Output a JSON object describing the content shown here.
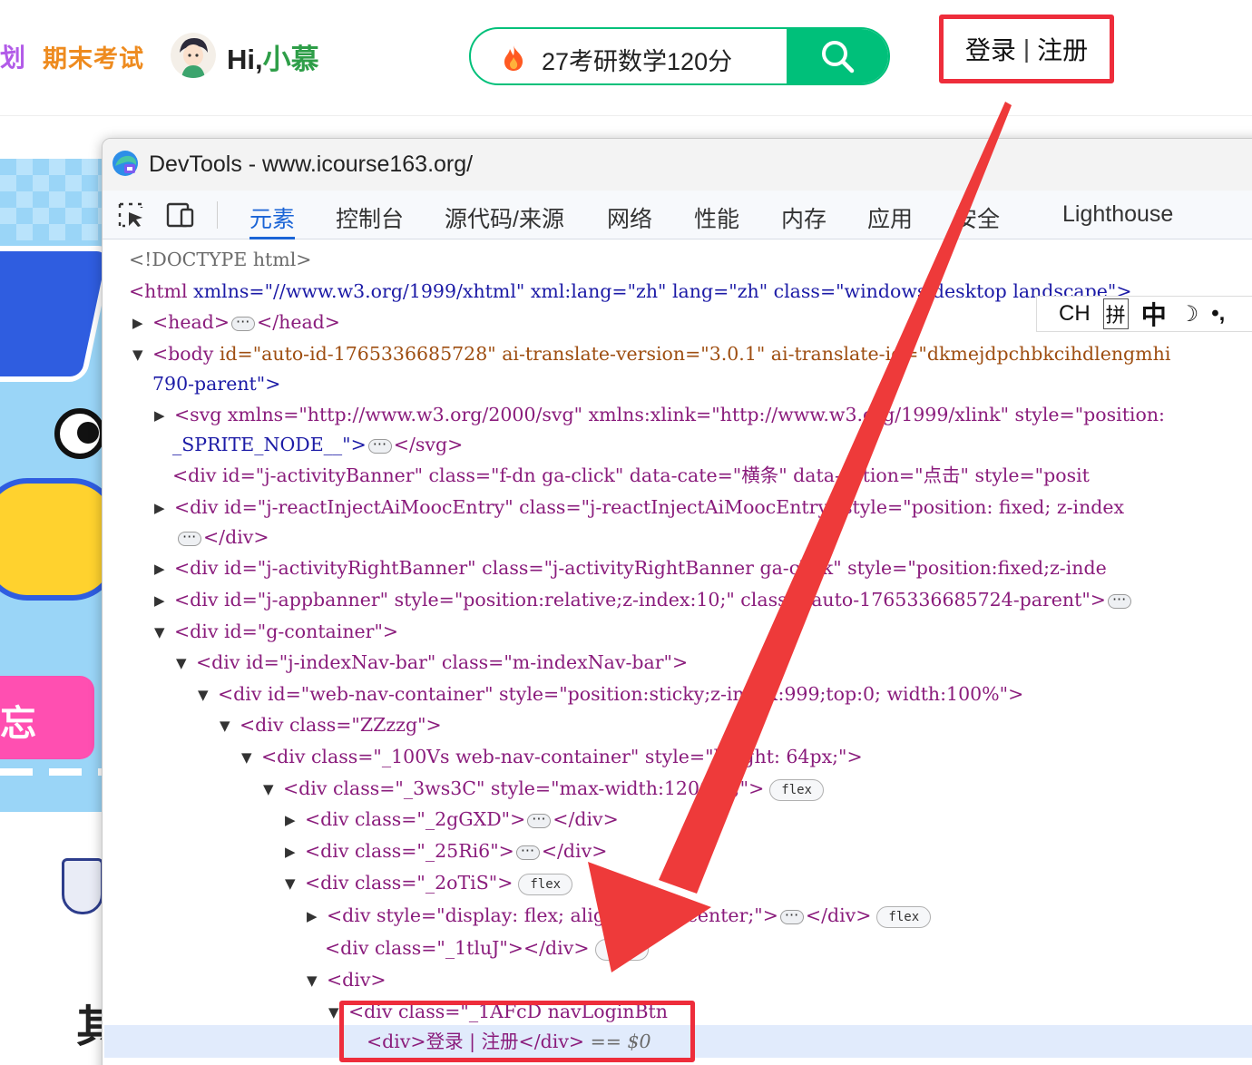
{
  "site": {
    "nav_partial": "划",
    "nav_exam": "期末考试",
    "greeting_hi": "Hi,",
    "greeting_name": "小慕",
    "search_query": "27考研数学120分",
    "login": "登录",
    "register": "注册",
    "login_sep": "|"
  },
  "background": {
    "banner_text": "忘",
    "page_char": "其",
    "page_dots": "..."
  },
  "devtools": {
    "title": "DevTools - www.icourse163.org/",
    "tabs": [
      "元素",
      "控制台",
      "源代码/来源",
      "网络",
      "性能",
      "内存",
      "应用",
      "安全",
      "Lighthouse"
    ],
    "active_tab": 0,
    "ime": {
      "ch": "CH",
      "pin": "拼",
      "zhong": "中",
      "moon": "☽",
      "dot": "•,"
    }
  },
  "dom_lines": {
    "l1": "<!DOCTYPE html>",
    "l2_tag": "<html",
    "l2_rest": " xmlns=\"//www.w3.org/1999/xhtml\" xml:lang=\"zh\" lang=\"zh\" class=\"windows desktop landscape\">",
    "l3_open": "<head>",
    "l3_close": "</head>",
    "l4_tag": "<body",
    "l4_attrs": " id=\"auto-id-1765336685728\" ai-translate-version=\"3.0.1\" ai-translate-id=\"dkmejdpchbkcihdlengmhi",
    "l5": "790-parent\">",
    "l6": "<svg xmlns=\"http://www.w3.org/2000/svg\" xmlns:xlink=\"http://www.w3.org/1999/xlink\" style=\"position:",
    "l7a": "_SPRITE_NODE__\">",
    "l7b": "</svg>",
    "l8": "<div id=\"j-activityBanner\" class=\"f-dn ga-click\" data-cate=\"横条\" data-action=\"点击\" style=\"posit",
    "l9": "<div id=\"j-reactInjectAiMoocEntry\" class=\"j-reactInjectAiMoocEntry\" style=\"position: fixed; z-index",
    "l10": "</div>",
    "l11": "<div id=\"j-activityRightBanner\" class=\"j-activityRightBanner ga-click\" style=\"position:fixed;z-inde",
    "l12": "<div id=\"j-appbanner\" style=\"position:relative;z-index:10;\" class=\"auto-1765336685724-parent\">",
    "l13": "<div id=\"g-container\">",
    "l14": "<div id=\"j-indexNav-bar\" class=\"m-indexNav-bar\">",
    "l15": "<div id=\"web-nav-container\" style=\"position:sticky;z-index:999;top:0; width:100%\">",
    "l16": "<div class=\"ZZzzg\">",
    "l17": "<div class=\"_100Vs web-nav-container\" style=\"height: 64px;\">",
    "l18": "<div class=\"_3ws3C\" style=\"max-width:1200px;\">",
    "l19a": "<div class=\"_2gGXD\">",
    "l19b": "</div>",
    "l20a": "<div class=\"_25Ri6\">",
    "l20b": "</div>",
    "l21": "<div class=\"_2oTiS\">",
    "l22a": "<div style=\"display: flex; align-items: center;\">",
    "l22b": "</div>",
    "l23": "<div class=\"_1tluJ\"></div>",
    "l24": "<div>",
    "l25": "<div class=\"_1AFcD navLoginBtn",
    "l26a": "<div>登录 | 注册</div>",
    "l26b": " == $0",
    "badge_flex": "flex"
  },
  "colors": {
    "accent_green": "#00c07a",
    "annotation_red": "#ee2d3b",
    "devtools_active": "#1a64d6",
    "tag_purple": "#8a1c7c",
    "attr_brown": "#9e4e11",
    "value_blue": "#1b1aa6"
  },
  "icons": [
    "flame-icon",
    "search-icon",
    "inspect-element-icon",
    "device-toolbar-icon",
    "edge-devtools-logo-icon",
    "collapse-triangle-icon",
    "expand-triangle-icon",
    "ellipsis-icon",
    "arrow-annotation-icon"
  ]
}
